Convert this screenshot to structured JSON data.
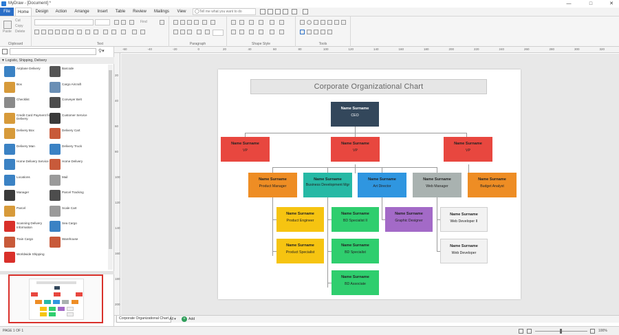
{
  "window": {
    "title": "MyDraw - [Document] *",
    "minimize": "—",
    "maximize": "□",
    "close": "✕"
  },
  "menu": {
    "items": [
      "File",
      "Home",
      "Design",
      "Action",
      "Arrange",
      "Insert",
      "Table",
      "Review",
      "Mailings",
      "View"
    ],
    "tell_me_placeholder": "Tell me what you want to do"
  },
  "ribbon": {
    "groups": [
      "Clipboard",
      "Text",
      "Paragraph",
      "Shape Style",
      "Tools"
    ],
    "paste": "Paste",
    "cut": "Cut",
    "copy": "Copy",
    "delete": "Delete",
    "find": "Find"
  },
  "library": {
    "category": "Logistic, Shipping, Delivery",
    "shapes": [
      {
        "label": "Airplane Delivery",
        "color": "#3b82c4"
      },
      {
        "label": "Barcode",
        "color": "#555555"
      },
      {
        "label": "Box",
        "color": "#d79a3a"
      },
      {
        "label": "Cargo Aircraft",
        "color": "#6a8fb5"
      },
      {
        "label": "Checklist",
        "color": "#8a8a8a"
      },
      {
        "label": "Conveyer Belt",
        "color": "#4d4d4d"
      },
      {
        "label": "Credit Card Payment for Delivery",
        "color": "#d79a3a"
      },
      {
        "label": "Customer Service",
        "color": "#3a3a3a"
      },
      {
        "label": "Delivery Box",
        "color": "#d79a3a"
      },
      {
        "label": "Delivery Cart",
        "color": "#c85a3a"
      },
      {
        "label": "Delivery Man",
        "color": "#3b82c4"
      },
      {
        "label": "Delivery Truck",
        "color": "#3b82c4"
      },
      {
        "label": "Home Delivery Service",
        "color": "#3b82c4"
      },
      {
        "label": "Home Delivery",
        "color": "#c85a3a"
      },
      {
        "label": "Locations",
        "color": "#3b82c4"
      },
      {
        "label": "Mail",
        "color": "#9a9a9a"
      },
      {
        "label": "Manager",
        "color": "#3a3a3a"
      },
      {
        "label": "Parcel Tracking",
        "color": "#4d4d4d"
      },
      {
        "label": "Parcel",
        "color": "#d79a3a"
      },
      {
        "label": "Scale Cart",
        "color": "#9a9a9a"
      },
      {
        "label": "Scanning Delivery Information",
        "color": "#d9302a"
      },
      {
        "label": "Sea Cargo",
        "color": "#3b82c4"
      },
      {
        "label": "Train Cargo",
        "color": "#c85a3a"
      },
      {
        "label": "Warehouse",
        "color": "#c85a3a"
      },
      {
        "label": "Worldwide Shipping",
        "color": "#d9302a"
      }
    ]
  },
  "rulers": {
    "h": [
      "-60",
      "-40",
      "-20",
      "0",
      "20",
      "40",
      "60",
      "80",
      "100",
      "120",
      "140",
      "160",
      "180",
      "200",
      "220",
      "240",
      "260",
      "280",
      "300",
      "320"
    ],
    "v": [
      "20",
      "40",
      "60",
      "80",
      "100",
      "120",
      "140",
      "160",
      "180",
      "200"
    ]
  },
  "chart": {
    "title": "Corporate Organizational Chart",
    "name_placeholder": "Name Surname",
    "colors": {
      "ceo": "#33475b",
      "vp": "#e8473f",
      "orange": "#ee8d24",
      "teal": "#26b9a5",
      "blue": "#2f96e0",
      "grey": "#a9b2b0",
      "yellow": "#f6c411",
      "green": "#2fce6e",
      "purple": "#a36ac7",
      "white": "#f2f2f2"
    },
    "nodes": {
      "ceo": "CEO",
      "vp1": "VP",
      "vp2": "VP",
      "vp3": "VP",
      "product_manager": "Product Manager",
      "bd_manager": "Business Development Mgr",
      "art_director": "Art Director",
      "web_manager": "Web Manager",
      "budget_analyst": "Budget Analyst",
      "product_engineer": "Product Engineer",
      "product_specialist": "Product Specialist",
      "bd_specialist_2": "BD Specialist II",
      "bd_specialist": "BD Specialist",
      "bd_associate": "BD Associate",
      "graphic_designer": "Graphic Designer",
      "web_developer_2": "Web Developer II",
      "web_developer": "Web Developer"
    }
  },
  "tabs": {
    "page": "Corporate Organizational Chart",
    "all": "All",
    "add": "Add",
    "add_icon": "plus-icon"
  },
  "status": {
    "page_count": "PAGE 1 OF 1",
    "zoom": "100%"
  }
}
